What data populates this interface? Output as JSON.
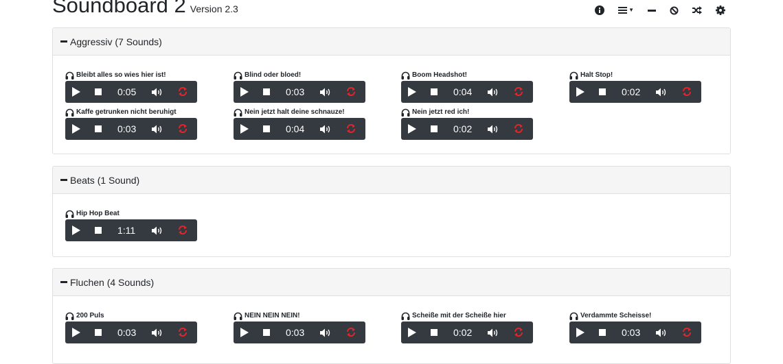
{
  "app": {
    "title": "Soundboard 2",
    "version": "Version 2.3"
  },
  "toolbar": [
    "info-icon",
    "list-icon",
    "collapse-icon",
    "ban-icon",
    "shuffle-icon",
    "gear-icon"
  ],
  "colors": {
    "player_bg": "#343a40",
    "loop_active": "#e3242b",
    "section_header_bg": "#f5f5f5",
    "border": "#dfdfdf"
  },
  "sections": [
    {
      "title": "Aggressiv (7 Sounds)",
      "sounds": [
        {
          "name": "Bleibt alles so wies hier ist!",
          "time": "0:05"
        },
        {
          "name": "Blind oder bloed!",
          "time": "0:03"
        },
        {
          "name": "Boom Headshot!",
          "time": "0:04"
        },
        {
          "name": "Halt Stop!",
          "time": "0:02"
        },
        {
          "name": "Kaffe getrunken nicht beruhigt",
          "time": "0:03"
        },
        {
          "name": "Nein jetzt halt deine schnauze!",
          "time": "0:04"
        },
        {
          "name": "Nein jetzt red ich!",
          "time": "0:02"
        }
      ]
    },
    {
      "title": "Beats (1 Sound)",
      "sounds": [
        {
          "name": "Hip Hop Beat",
          "time": "1:11"
        }
      ]
    },
    {
      "title": "Fluchen (4 Sounds)",
      "sounds": [
        {
          "name": "200 Puls",
          "time": "0:03"
        },
        {
          "name": "NEIN NEIN NEIN!",
          "time": "0:03"
        },
        {
          "name": "Scheiße mit der Scheiße hier",
          "time": "0:02"
        },
        {
          "name": "Verdammte Scheisse!",
          "time": "0:03"
        }
      ]
    }
  ]
}
